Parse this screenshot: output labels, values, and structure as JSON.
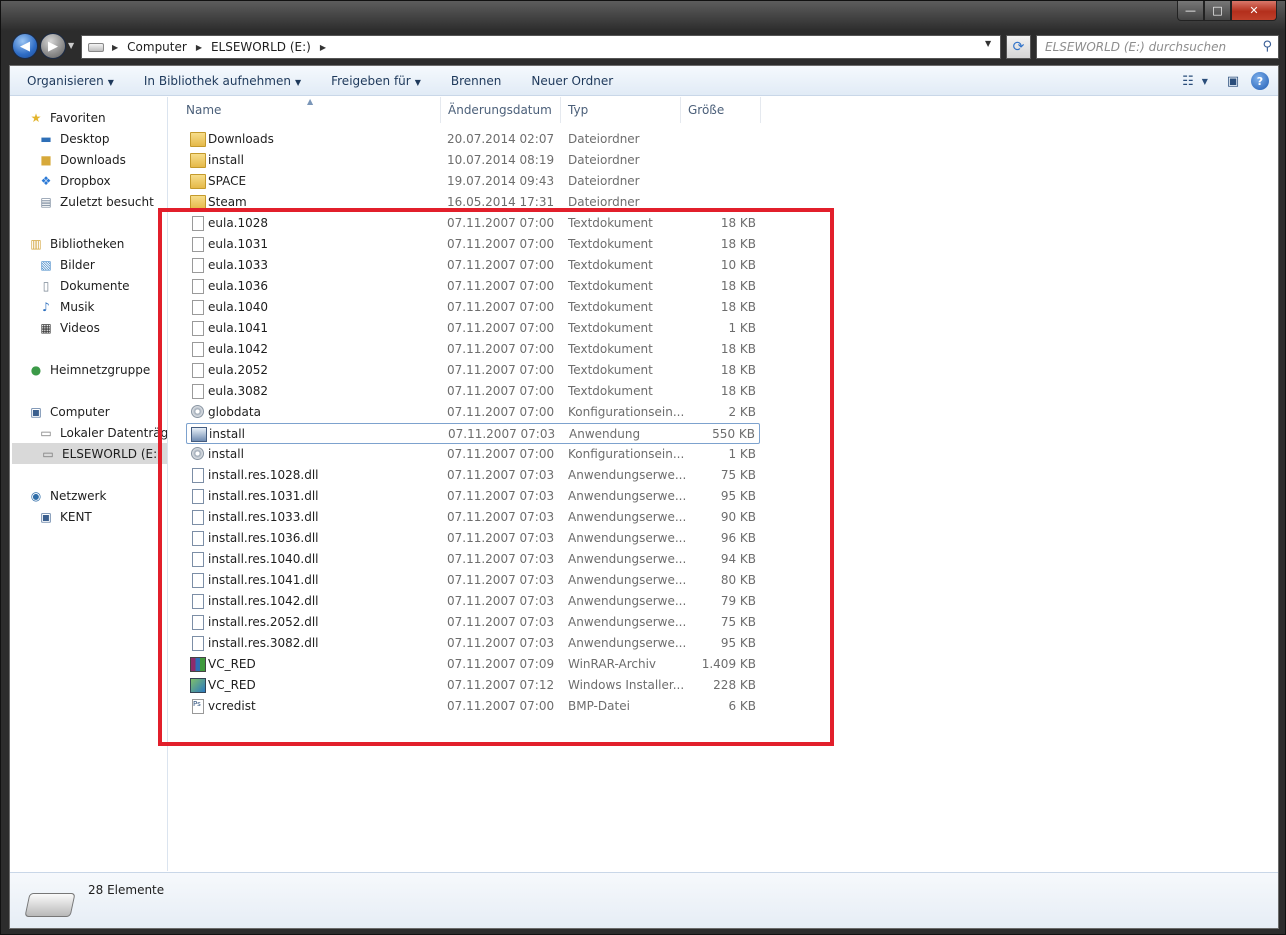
{
  "window": {
    "controls": {
      "minimize": "—",
      "maximize": "□",
      "close": "✕"
    }
  },
  "address_bar": {
    "crumbs": [
      "Computer",
      "ELSEWORLD (E:)"
    ],
    "search_placeholder": "ELSEWORLD (E:) durchsuchen"
  },
  "toolbar": {
    "items": [
      {
        "label": "Organisieren",
        "dropdown": true
      },
      {
        "label": "In Bibliothek aufnehmen",
        "dropdown": true
      },
      {
        "label": "Freigeben für",
        "dropdown": true
      },
      {
        "label": "Brennen",
        "dropdown": false
      },
      {
        "label": "Neuer Ordner",
        "dropdown": false
      }
    ]
  },
  "nav_pane": {
    "favorites": {
      "label": "Favoriten",
      "items": [
        "Desktop",
        "Downloads",
        "Dropbox",
        "Zuletzt besucht"
      ]
    },
    "libraries": {
      "label": "Bibliotheken",
      "items": [
        "Bilder",
        "Dokumente",
        "Musik",
        "Videos"
      ]
    },
    "homegroup": {
      "label": "Heimnetzgruppe"
    },
    "computer": {
      "label": "Computer",
      "items": [
        "Lokaler Datenträger",
        "ELSEWORLD (E:)"
      ],
      "selected": "ELSEWORLD (E:)"
    },
    "network": {
      "label": "Netzwerk",
      "items": [
        "KENT"
      ]
    }
  },
  "columns": {
    "name": "Name",
    "date": "Änderungsdatum",
    "type": "Typ",
    "size": "Größe"
  },
  "files": [
    {
      "name": "Downloads",
      "date": "20.07.2014 02:07",
      "type": "Dateiordner",
      "size": "",
      "icon": "folder-icon"
    },
    {
      "name": "install",
      "date": "10.07.2014 08:19",
      "type": "Dateiordner",
      "size": "",
      "icon": "folder-icon"
    },
    {
      "name": "SPACE",
      "date": "19.07.2014 09:43",
      "type": "Dateiordner",
      "size": "",
      "icon": "locked-folder-icon"
    },
    {
      "name": "Steam",
      "date": "16.05.2014 17:31",
      "type": "Dateiordner",
      "size": "",
      "icon": "folder-icon"
    },
    {
      "name": "eula.1028",
      "date": "07.11.2007 07:00",
      "type": "Textdokument",
      "size": "18 KB",
      "icon": "text-file-icon"
    },
    {
      "name": "eula.1031",
      "date": "07.11.2007 07:00",
      "type": "Textdokument",
      "size": "18 KB",
      "icon": "text-file-icon"
    },
    {
      "name": "eula.1033",
      "date": "07.11.2007 07:00",
      "type": "Textdokument",
      "size": "10 KB",
      "icon": "text-file-icon"
    },
    {
      "name": "eula.1036",
      "date": "07.11.2007 07:00",
      "type": "Textdokument",
      "size": "18 KB",
      "icon": "text-file-icon"
    },
    {
      "name": "eula.1040",
      "date": "07.11.2007 07:00",
      "type": "Textdokument",
      "size": "18 KB",
      "icon": "text-file-icon"
    },
    {
      "name": "eula.1041",
      "date": "07.11.2007 07:00",
      "type": "Textdokument",
      "size": "1 KB",
      "icon": "text-file-icon"
    },
    {
      "name": "eula.1042",
      "date": "07.11.2007 07:00",
      "type": "Textdokument",
      "size": "18 KB",
      "icon": "text-file-icon"
    },
    {
      "name": "eula.2052",
      "date": "07.11.2007 07:00",
      "type": "Textdokument",
      "size": "18 KB",
      "icon": "text-file-icon"
    },
    {
      "name": "eula.3082",
      "date": "07.11.2007 07:00",
      "type": "Textdokument",
      "size": "18 KB",
      "icon": "text-file-icon"
    },
    {
      "name": "globdata",
      "date": "07.11.2007 07:00",
      "type": "Konfigurationsein...",
      "size": "2 KB",
      "icon": "config-file-icon"
    },
    {
      "name": "install",
      "date": "07.11.2007 07:03",
      "type": "Anwendung",
      "size": "550 KB",
      "icon": "installer-app-icon",
      "focused": true
    },
    {
      "name": "install",
      "date": "07.11.2007 07:00",
      "type": "Konfigurationsein...",
      "size": "1 KB",
      "icon": "config-file-icon"
    },
    {
      "name": "install.res.1028.dll",
      "date": "07.11.2007 07:03",
      "type": "Anwendungserwe...",
      "size": "75 KB",
      "icon": "dll-file-icon"
    },
    {
      "name": "install.res.1031.dll",
      "date": "07.11.2007 07:03",
      "type": "Anwendungserwe...",
      "size": "95 KB",
      "icon": "dll-file-icon"
    },
    {
      "name": "install.res.1033.dll",
      "date": "07.11.2007 07:03",
      "type": "Anwendungserwe...",
      "size": "90 KB",
      "icon": "dll-file-icon"
    },
    {
      "name": "install.res.1036.dll",
      "date": "07.11.2007 07:03",
      "type": "Anwendungserwe...",
      "size": "96 KB",
      "icon": "dll-file-icon"
    },
    {
      "name": "install.res.1040.dll",
      "date": "07.11.2007 07:03",
      "type": "Anwendungserwe...",
      "size": "94 KB",
      "icon": "dll-file-icon"
    },
    {
      "name": "install.res.1041.dll",
      "date": "07.11.2007 07:03",
      "type": "Anwendungserwe...",
      "size": "80 KB",
      "icon": "dll-file-icon"
    },
    {
      "name": "install.res.1042.dll",
      "date": "07.11.2007 07:03",
      "type": "Anwendungserwe...",
      "size": "79 KB",
      "icon": "dll-file-icon"
    },
    {
      "name": "install.res.2052.dll",
      "date": "07.11.2007 07:03",
      "type": "Anwendungserwe...",
      "size": "75 KB",
      "icon": "dll-file-icon"
    },
    {
      "name": "install.res.3082.dll",
      "date": "07.11.2007 07:03",
      "type": "Anwendungserwe...",
      "size": "95 KB",
      "icon": "dll-file-icon"
    },
    {
      "name": "VC_RED",
      "date": "07.11.2007 07:09",
      "type": "WinRAR-Archiv",
      "size": "1.409 KB",
      "icon": "winrar-archive-icon"
    },
    {
      "name": "VC_RED",
      "date": "07.11.2007 07:12",
      "type": "Windows Installer...",
      "size": "228 KB",
      "icon": "msi-installer-icon"
    },
    {
      "name": "vcredist",
      "date": "07.11.2007 07:00",
      "type": "BMP-Datei",
      "size": "6 KB",
      "icon": "bmp-file-icon"
    }
  ],
  "details_pane": {
    "item_count": "28 Elemente"
  },
  "highlight": {
    "color": "#e21f2b"
  }
}
